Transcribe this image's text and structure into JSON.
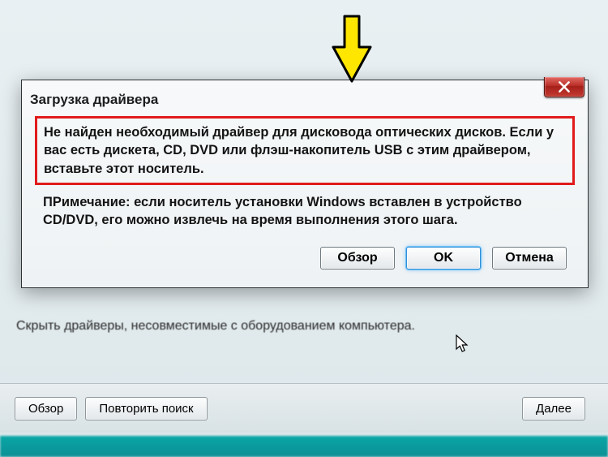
{
  "parent": {
    "checkbox_label": "Скрыть драйверы, несовместимые с оборудованием компьютера.",
    "buttons": {
      "browse": "Обзор",
      "rescan": "Повторить поиск",
      "next": "Далее"
    }
  },
  "dialog": {
    "title": "Загрузка драйвера",
    "message": "Не найден необходимый драйвер для дисковода оптических дисков. Если у вас есть дискета, CD, DVD или флэш-накопитель USB с этим драйвером, вставьте этот носитель.",
    "note": "ПРимечание: если носитель установки Windows вставлен в устройство CD/DVD, его можно извлечь на время выполнения этого шага.",
    "buttons": {
      "browse": "Обзор",
      "ok": "OK",
      "cancel": "Отмена"
    }
  }
}
